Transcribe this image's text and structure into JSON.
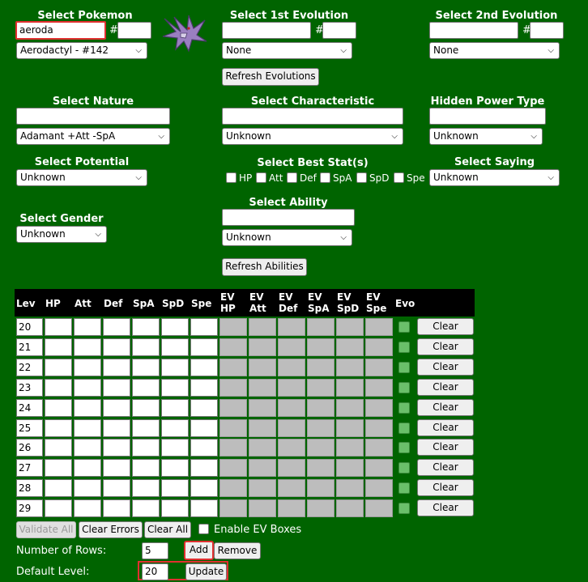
{
  "pokemon": {
    "label": "Select Pokemon",
    "search_value": "aeroda",
    "number_value": "",
    "hash": "#",
    "selected": "Aerodactyl - #142",
    "sprite_icon": "aerodactyl-sprite-icon"
  },
  "evo1": {
    "label": "Select 1st Evolution",
    "search_value": "",
    "hash": "#",
    "selected": "None",
    "refresh_label": "Refresh Evolutions"
  },
  "evo2": {
    "label": "Select 2nd Evolution",
    "search_value": "",
    "hash": "#",
    "selected": "None"
  },
  "nature": {
    "label": "Select Nature",
    "search_value": "",
    "selected": "Adamant +Att -SpA"
  },
  "characteristic": {
    "label": "Select Characteristic",
    "search_value": "",
    "selected": "Unknown"
  },
  "hidden_power": {
    "label": "Hidden Power Type",
    "search_value": "",
    "selected": "Unknown"
  },
  "potential": {
    "label": "Select Potential",
    "selected": "Unknown"
  },
  "best_stats": {
    "label": "Select Best Stat(s)",
    "options": [
      "HP",
      "Att",
      "Def",
      "SpA",
      "SpD",
      "Spe"
    ]
  },
  "saying": {
    "label": "Select Saying",
    "selected": "Unknown"
  },
  "ability": {
    "label": "Select Ability",
    "search_value": "",
    "selected": "Unknown",
    "refresh_label": "Refresh Abilities"
  },
  "gender": {
    "label": "Select Gender",
    "selected": "Unknown"
  },
  "table": {
    "headers": [
      "Lev",
      "HP",
      "Att",
      "Def",
      "SpA",
      "SpD",
      "Spe",
      "EV HP",
      "EV Att",
      "EV Def",
      "EV SpA",
      "EV SpD",
      "EV Spe",
      "Evo"
    ],
    "levels": [
      "20",
      "21",
      "22",
      "23",
      "24",
      "25",
      "26",
      "27",
      "28",
      "29"
    ],
    "clear_label": "Clear"
  },
  "controls": {
    "validate_all": "Validate All",
    "clear_errors": "Clear Errors",
    "clear_all": "Clear All",
    "enable_ev": "Enable EV Boxes",
    "rows_label": "Number of Rows:",
    "rows_value": "5",
    "add": "Add",
    "remove": "Remove",
    "level_label": "Default Level:",
    "level_value": "20",
    "update": "Update"
  },
  "colors": {
    "background": "#006400",
    "highlight": "#e03030",
    "header_bg": "#000000"
  }
}
